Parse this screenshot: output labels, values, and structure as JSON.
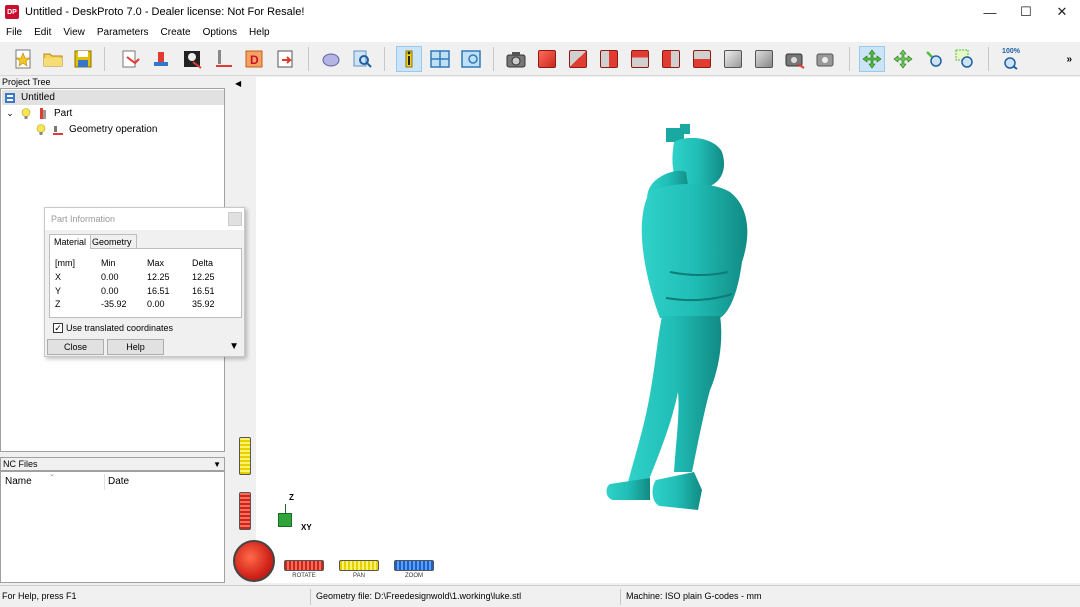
{
  "window": {
    "title": "Untitled - DeskProto 7.0 - Dealer license: Not For Resale!",
    "app_icon_text": "DP",
    "minimize_glyph": "—",
    "maximize_glyph": "☐",
    "close_glyph": "✕"
  },
  "menu": [
    "File",
    "Edit",
    "View",
    "Parameters",
    "Create",
    "Options",
    "Help"
  ],
  "toolbar": {
    "zoom_label": "100%",
    "more_glyph": "»",
    "icons": [
      "new-file-icon",
      "open-folder-icon",
      "save-icon",
      "wizard-icon",
      "part-wizard-icon",
      "bitmap-wizard-icon",
      "toolpath-icon",
      "drawing-icon",
      "export-icon",
      "eraser-icon",
      "find-icon",
      "info-icon",
      "window-icon",
      "preview-icon",
      "camera-icon",
      "view-top-icon",
      "view-front-icon",
      "view-side-icon",
      "view-back-icon",
      "view-left-icon",
      "view-right-icon",
      "view-iso-icon",
      "view-bottom-icon",
      "snapshot-icon",
      "snapshot-settings-icon",
      "rotate-icon",
      "pan-icon",
      "zoom-icon",
      "zoom-window-icon",
      "zoom-100-icon"
    ],
    "accent": "#e03c31"
  },
  "project_tree": {
    "header": "Project Tree",
    "root": "Untitled",
    "part": "Part",
    "operation": "Geometry operation"
  },
  "nc_files": {
    "header": "NC Files",
    "col_name": "Name",
    "col_date": "Date"
  },
  "part_info": {
    "title": "Part Information",
    "tabs": [
      "Material",
      "Geometry"
    ],
    "columns": [
      "[mm]",
      "Min",
      "Max",
      "Delta"
    ],
    "rows": [
      {
        "axis": "X",
        "min": "0.00",
        "max": "12.25",
        "delta": "12.25"
      },
      {
        "axis": "Y",
        "min": "0.00",
        "max": "16.51",
        "delta": "16.51"
      },
      {
        "axis": "Z",
        "min": "-35.92",
        "max": "0.00",
        "delta": "35.92"
      }
    ],
    "checkbox_label": "Use translated coordinates",
    "checkbox_mark": "✓",
    "close_label": "Close",
    "help_label": "Help",
    "more_glyph": "▼"
  },
  "viewport": {
    "axis_z": "Z",
    "axis_xy": "XY",
    "rotate_label": "ROTATE",
    "pan_label": "PAN",
    "zoom_label": "ZOOM",
    "model_color": "#20bdb5"
  },
  "status": {
    "help": "For Help, press F1",
    "geometry_file": "Geometry file: D:\\Freedesignwold\\1.working\\luke.stl",
    "machine": "Machine: ISO plain G-codes - mm"
  }
}
